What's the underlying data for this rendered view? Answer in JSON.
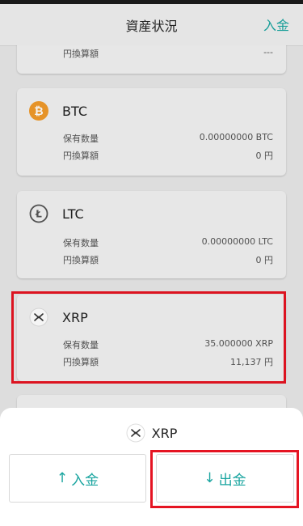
{
  "header": {
    "title": "資産状況",
    "action": "入金"
  },
  "cards": [
    {
      "name": "",
      "holdings_label": "",
      "holdings_value": "",
      "jpy_label": "円換算額",
      "jpy_value": "---"
    },
    {
      "name": "BTC",
      "icon": "bitcoin-icon",
      "holdings_label": "保有数量",
      "holdings_value": "0.00000000 BTC",
      "jpy_label": "円換算額",
      "jpy_value": "0 円"
    },
    {
      "name": "LTC",
      "icon": "litecoin-icon",
      "holdings_label": "保有数量",
      "holdings_value": "0.00000000 LTC",
      "jpy_label": "円換算額",
      "jpy_value": "0 円"
    },
    {
      "name": "XRP",
      "icon": "xrp-icon",
      "holdings_label": "保有数量",
      "holdings_value": "35.000000 XRP",
      "jpy_label": "円換算額",
      "jpy_value": "11,137 円"
    }
  ],
  "sheet": {
    "coin": "XRP",
    "deposit_label": "入金",
    "withdraw_label": "出金"
  },
  "colors": {
    "accent": "#1aa5a0",
    "highlight": "#e51422",
    "bitcoin": "#f09a2a"
  }
}
